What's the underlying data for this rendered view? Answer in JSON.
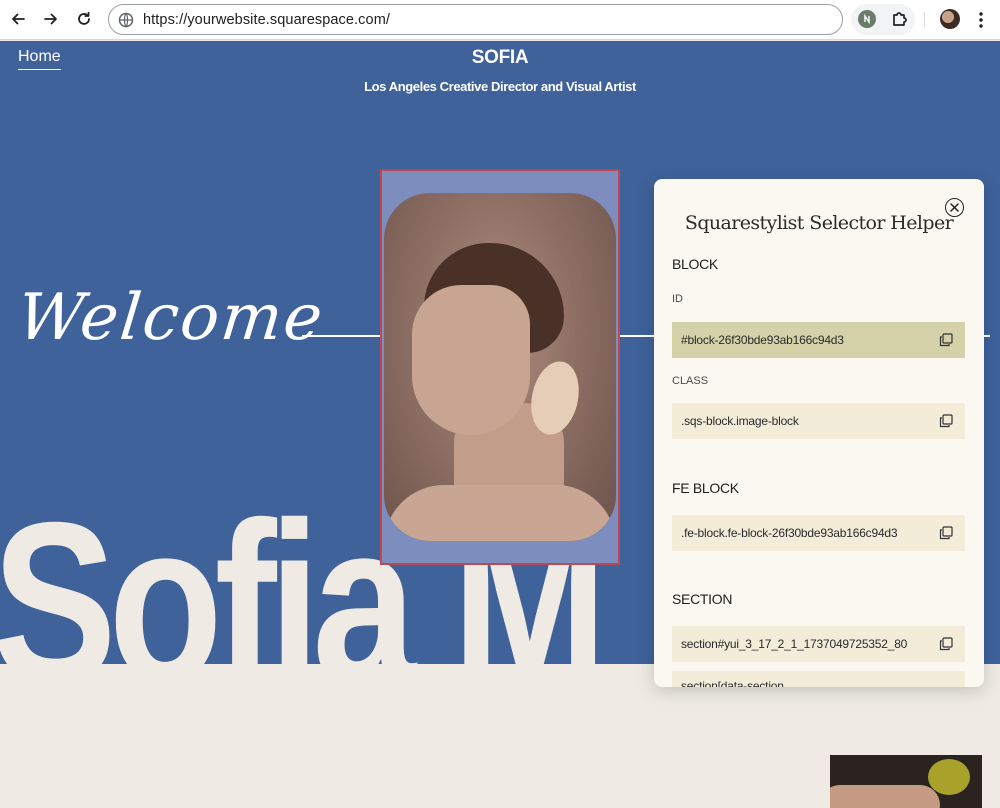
{
  "browser": {
    "url": "https://yourwebsite.squarespace.com/",
    "icons": [
      "back-arrow-icon",
      "forward-arrow-icon",
      "reload-icon",
      "site-info-icon",
      "extension-icon",
      "puzzle-icon",
      "profile-avatar",
      "more-menu-icon"
    ]
  },
  "site": {
    "nav_home": "Home",
    "title": "SOFIA",
    "subtitle": "Los Angeles Creative Director and Visual Artist",
    "welcome": "Welcome",
    "big_name": "Sofia M",
    "colors": {
      "hero_bg": "#3f629b",
      "page_bg": "#efebe4",
      "highlight_border": "#c0464f"
    }
  },
  "panel": {
    "title": "Squarestylist Selector Helper",
    "block_heading": "BLOCK",
    "id_label": "ID",
    "id_value": "#block-26f30bde93ab166c94d3",
    "class_label": "CLASS",
    "class_value": ".sqs-block.image-block",
    "fe_heading": "FE BLOCK",
    "fe_value": ".fe-block.fe-block-26f30bde93ab166c94d3",
    "section_heading": "SECTION",
    "section_value": "section#yui_3_17_2_1_1737049725352_80",
    "section_value_2": "section[data-section"
  }
}
